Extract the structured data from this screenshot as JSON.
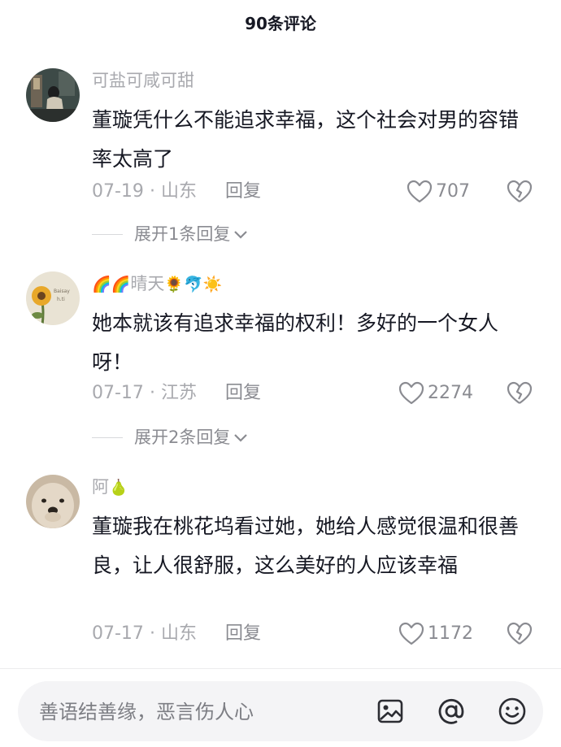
{
  "header": {
    "title": "90条评论"
  },
  "comments": [
    {
      "username": "可盐可咸可甜",
      "name_emojis": "",
      "text": "董璇凭什么不能追求幸福，这个社会对男的容错率太高了",
      "date": "07-19",
      "location": "山东",
      "separator": "·",
      "reply_label": "回复",
      "likes": "707",
      "expand_label": "展开1条回复"
    },
    {
      "username_prefix": "🌈🌈",
      "username": "晴天",
      "name_emojis": "🌻🐬☀️",
      "text": "她本就该有追求幸福的权利！多好的一个女人呀！",
      "date": "07-17",
      "location": "江苏",
      "separator": "·",
      "reply_label": "回复",
      "likes": "2274",
      "expand_label": "展开2条回复"
    },
    {
      "username": "阿",
      "name_emojis": "🍐",
      "text": "董璇我在桃花坞看过她，她给人感觉很温和很善良，让人很舒服，这么美好的人应该幸福",
      "date": "07-17",
      "location": "山东",
      "separator": "·",
      "reply_label": "回复",
      "likes": "1172"
    }
  ],
  "input": {
    "placeholder": "善语结善缘，恶言伤人心"
  },
  "icons": [
    "heart-outline-icon",
    "broken-heart-icon",
    "chevron-down-icon",
    "image-icon",
    "at-icon",
    "emoji-icon"
  ]
}
